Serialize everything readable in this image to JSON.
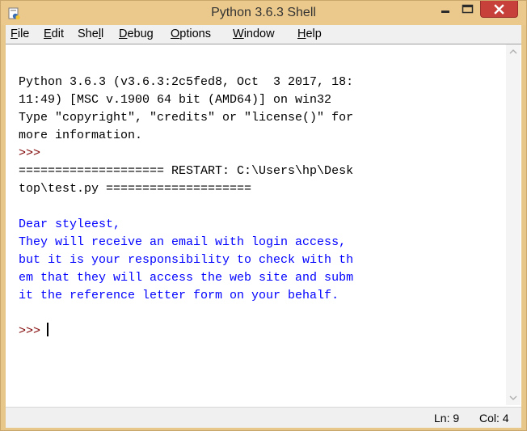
{
  "window": {
    "title": "Python 3.6.3 Shell",
    "accent": "#ebc98c",
    "close_color": "#c7403a"
  },
  "menu": {
    "items": [
      {
        "label": "File",
        "underline": "F"
      },
      {
        "label": "Edit",
        "underline": "E"
      },
      {
        "label": "Shell",
        "underline": "l"
      },
      {
        "label": "Debug",
        "underline": "D"
      },
      {
        "label": "Options",
        "underline": "O"
      },
      {
        "label": "Window",
        "underline": "W"
      },
      {
        "label": "Help",
        "underline": "H"
      }
    ]
  },
  "console": {
    "lines": [
      {
        "text": "Python 3.6.3 (v3.6.3:2c5fed8, Oct  3 2017, 18:",
        "color": "#000000"
      },
      {
        "text": "11:49) [MSC v.1900 64 bit (AMD64)] on win32",
        "color": "#000000"
      },
      {
        "text": "Type \"copyright\", \"credits\" or \"license()\" for",
        "color": "#000000"
      },
      {
        "text": "more information.",
        "color": "#000000"
      },
      {
        "text": ">>>",
        "color": "#7f0000"
      },
      {
        "text": "==================== RESTART: C:\\Users\\hp\\Desk",
        "color": "#000000"
      },
      {
        "text": "top\\test.py ====================",
        "color": "#000000"
      },
      {
        "text": "",
        "color": "#000000"
      },
      {
        "text": "Dear styleest,",
        "color": "#0000ff"
      },
      {
        "text": "They will receive an email with login access,",
        "color": "#0000ff"
      },
      {
        "text": "but it is your responsibility to check with th",
        "color": "#0000ff"
      },
      {
        "text": "em that they will access the web site and subm",
        "color": "#0000ff"
      },
      {
        "text": "it the reference letter form on your behalf.",
        "color": "#0000ff"
      },
      {
        "text": "",
        "color": "#000000"
      }
    ],
    "prompt": ">>>"
  },
  "status": {
    "line": "Ln: 9",
    "col": "Col: 4"
  }
}
